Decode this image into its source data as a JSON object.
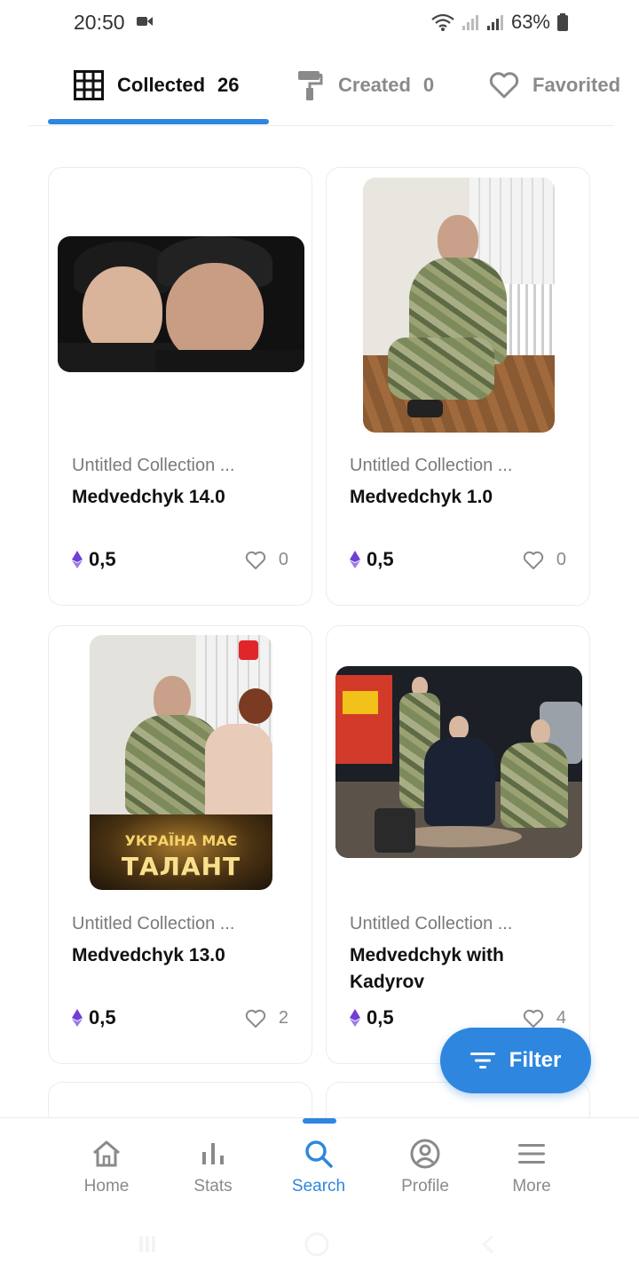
{
  "status_bar": {
    "time": "20:50",
    "battery": "63%"
  },
  "tabs": [
    {
      "label": "Collected",
      "count": "26",
      "icon": "grid-icon",
      "active": true
    },
    {
      "label": "Created",
      "count": "0",
      "icon": "paint-roller-icon",
      "active": false
    },
    {
      "label": "Favorited",
      "count": "",
      "icon": "heart-icon",
      "active": false
    }
  ],
  "cards": [
    {
      "collection": "Untitled Collection ...",
      "name": "Medvedchyk 14.0",
      "price": "0,5",
      "likes": "0"
    },
    {
      "collection": "Untitled Collection ...",
      "name": "Medvedchyk 1.0",
      "price": "0,5",
      "likes": "0"
    },
    {
      "collection": "Untitled Collection ...",
      "name": "Medvedchyk 13.0",
      "price": "0,5",
      "likes": "2"
    },
    {
      "collection": "Untitled Collection ...",
      "name": "Medvedchyk with Kadyrov",
      "price": "0,5",
      "likes": "4"
    }
  ],
  "thumbnail_text": {
    "talent_line1": "УКРАЇНА МАЄ",
    "talent_line2": "ТАЛАНТ"
  },
  "filter_button": {
    "label": "Filter"
  },
  "bottom_nav": [
    {
      "label": "Home",
      "icon": "home-icon"
    },
    {
      "label": "Stats",
      "icon": "bar-chart-icon"
    },
    {
      "label": "Search",
      "icon": "search-icon",
      "active": true
    },
    {
      "label": "Profile",
      "icon": "profile-icon"
    },
    {
      "label": "More",
      "icon": "menu-icon"
    }
  ],
  "colors": {
    "accent": "#2e86de",
    "eth": "#6f3fd6",
    "text": "#111111",
    "muted": "#8a8a8a"
  }
}
